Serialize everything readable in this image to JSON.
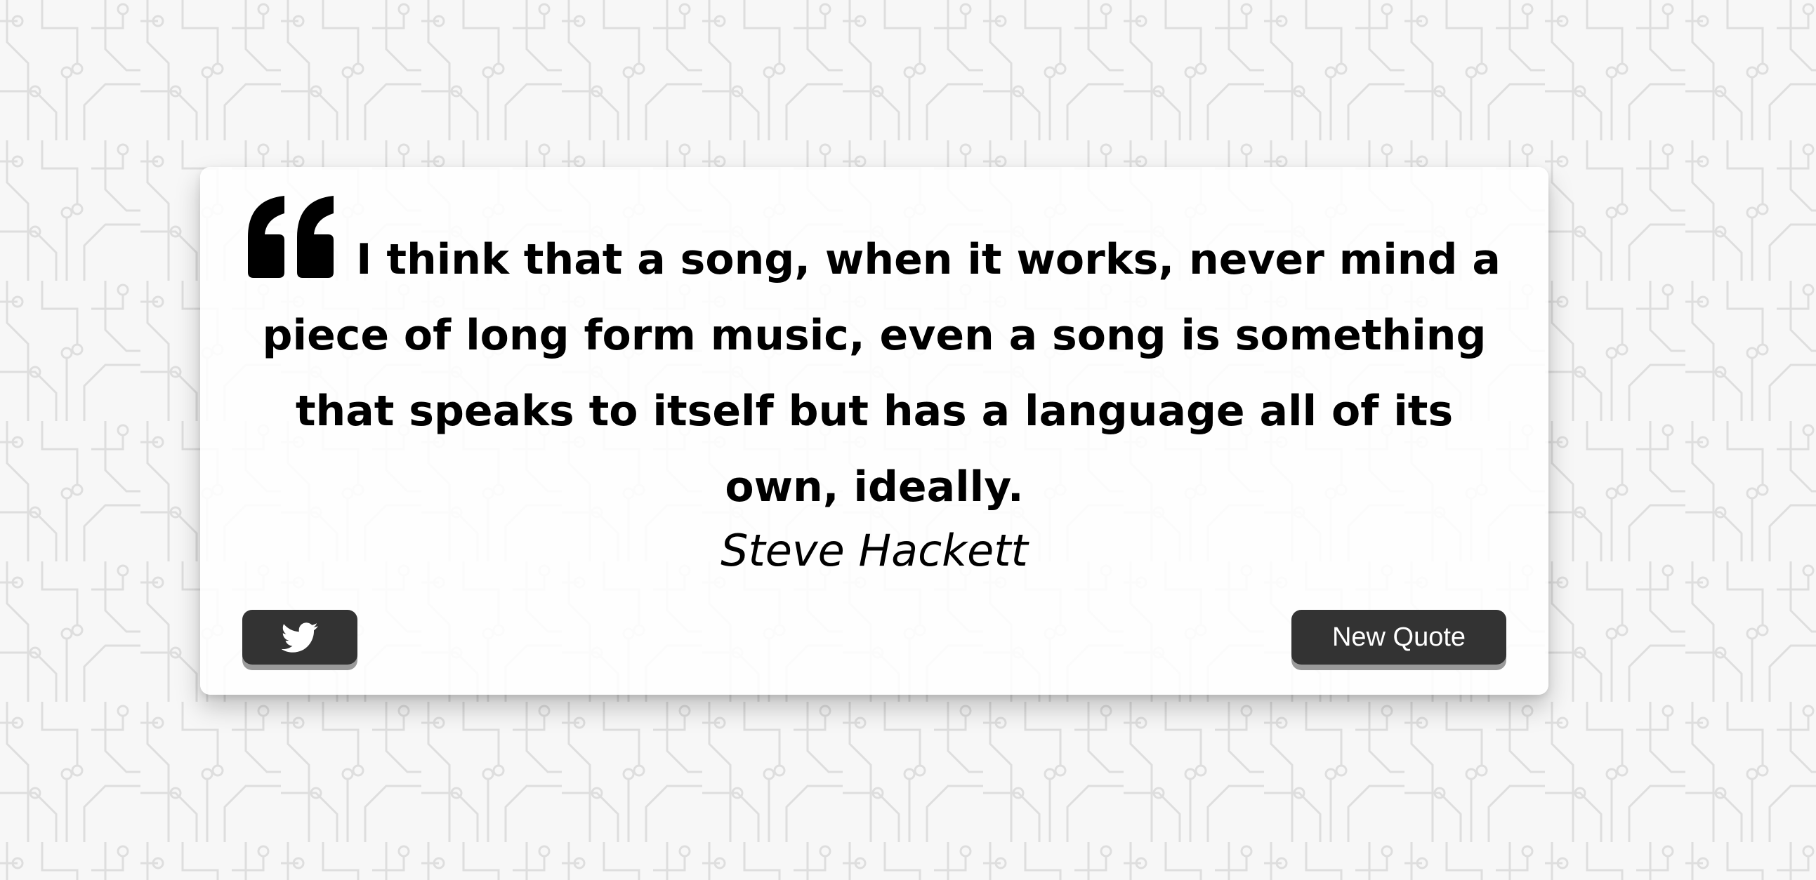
{
  "quote": {
    "text": "I think that a song, when it works, never mind a piece of long form music, even a song is something that speaks to itself but has a language all of its own, ideally.",
    "author": "Steve Hackett",
    "quote_icon": "quote-left-icon"
  },
  "actions": {
    "twitter_icon": "twitter-icon",
    "new_quote_label": "New Quote"
  },
  "colors": {
    "button_bg": "#333333",
    "button_text": "#ffffff",
    "card_bg": "#ffffff",
    "pattern": "#dcdcdc"
  }
}
